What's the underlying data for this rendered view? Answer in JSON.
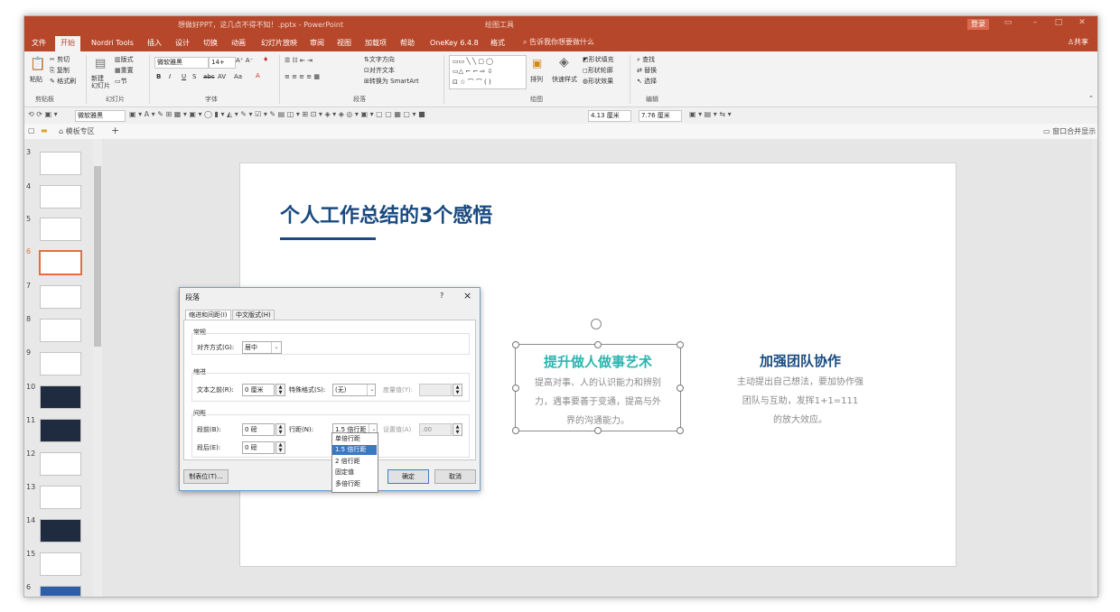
{
  "titlebar": {
    "title": "想做好PPT，这几点不得不知！.pptx  -  PowerPoint",
    "context_tab": "绘图工具",
    "login": "登录"
  },
  "menu": {
    "tabs": [
      "文件",
      "开始",
      "Nordri Tools",
      "插入",
      "设计",
      "切换",
      "动画",
      "幻灯片放映",
      "审阅",
      "视图",
      "加载项",
      "帮助",
      "OneKey 6.4.8",
      "格式"
    ],
    "active_tab": "开始",
    "search": "告诉我你想要做什么",
    "share": "共享"
  },
  "ribbon": {
    "clipboard": {
      "paste": "粘贴",
      "cut": "剪切",
      "copy": "复制",
      "format_painter": "格式刷",
      "group": "剪贴板"
    },
    "slides": {
      "new_slide": "新建\n幻灯片",
      "layout": "版式",
      "reset": "重置",
      "section": "节",
      "group": "幻灯片"
    },
    "font": {
      "family": "微软雅黑",
      "size": "14+",
      "group": "字体"
    },
    "paragraph": {
      "text_direction": "文字方向",
      "align_text": "对齐文本",
      "smartart": "转换为 SmartArt",
      "group": "段落"
    },
    "drawing": {
      "arrange": "排列",
      "quick_styles": "快速样式",
      "fill": "形状填充",
      "outline": "形状轮廓",
      "effects": "形状效果",
      "group": "绘图"
    },
    "editing": {
      "find": "查找",
      "replace": "替换",
      "select": "选择",
      "group": "编辑"
    }
  },
  "qat": {
    "font": "微软雅黑",
    "width": "4.13 厘米",
    "height": "7.76 厘米"
  },
  "tabbar": {
    "template": "模板专区",
    "window": "窗口合并显示"
  },
  "thumbnails": [
    "3",
    "4",
    "5",
    "6",
    "7",
    "8",
    "9",
    "10",
    "11",
    "12",
    "13",
    "14",
    "15",
    "6"
  ],
  "selected_slide": "6",
  "slide": {
    "title": "个人工作总结的3个感悟",
    "block1": {
      "heading": "提升做人做事艺术",
      "body": [
        "提高对事、人的认识能力和辨别",
        "力，遇事要善于变通，提高与外",
        "界的沟通能力。"
      ]
    },
    "block2": {
      "heading": "加强团队协作",
      "body": [
        "主动提出自己想法，要加协作强",
        "团队与互助，发挥1+1=111",
        "的放大效应。"
      ]
    }
  },
  "dialog": {
    "title": "段落",
    "help": "?",
    "close": "×",
    "tabs": [
      "缩进和间距(I)",
      "中文版式(H)"
    ],
    "general": {
      "label": "常规",
      "align_label": "对齐方式(G):",
      "align_value": "居中"
    },
    "indent": {
      "label": "缩进",
      "before_label": "文本之前(R):",
      "before_value": "0 厘米",
      "special_label": "特殊格式(S):",
      "special_value": "(无)",
      "by_label": "度量值(Y):",
      "by_value": ""
    },
    "spacing": {
      "label": "间距",
      "before_label": "段前(B):",
      "before_value": "0 磅",
      "after_label": "段后(E):",
      "after_value": "0 磅",
      "line_label": "行距(N):",
      "line_value": "1.5 倍行距",
      "at_label": "设置值(A)",
      "at_value": ".00"
    },
    "buttons": {
      "tabs": "制表位(T)...",
      "ok": "确定",
      "cancel": "取消"
    },
    "line_options": [
      "单倍行距",
      "1.5 倍行距",
      "2 倍行距",
      "固定值",
      "多倍行距"
    ],
    "line_selected": "1.5 倍行距"
  },
  "colors": {
    "accent": "#b7472a",
    "title": "#1a4a80",
    "teal": "#2bb5b0",
    "navy": "#1a4a80"
  }
}
